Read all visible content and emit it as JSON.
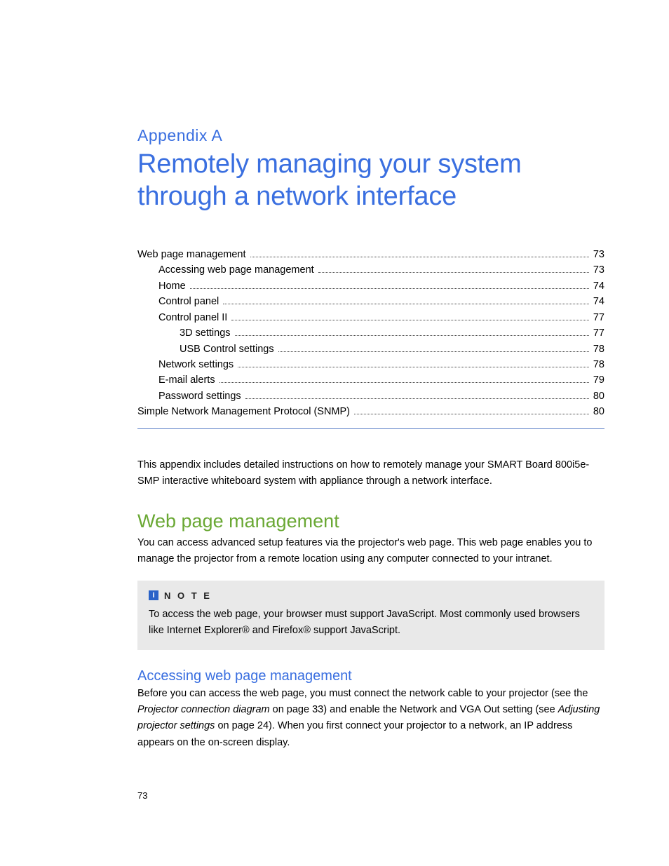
{
  "appendix_label": "Appendix  A",
  "chapter_title": "Remotely managing your system through a network interface",
  "toc": [
    {
      "label": "Web page management",
      "page": "73",
      "indent": 0
    },
    {
      "label": "Accessing web page management",
      "page": "73",
      "indent": 1
    },
    {
      "label": "Home",
      "page": "74",
      "indent": 1
    },
    {
      "label": "Control panel",
      "page": "74",
      "indent": 1
    },
    {
      "label": "Control panel II",
      "page": "77",
      "indent": 1
    },
    {
      "label": "3D settings",
      "page": "77",
      "indent": 2
    },
    {
      "label": "USB Control settings",
      "page": "78",
      "indent": 2
    },
    {
      "label": "Network settings",
      "page": "78",
      "indent": 1
    },
    {
      "label": "E-mail alerts",
      "page": "79",
      "indent": 1
    },
    {
      "label": "Password settings",
      "page": "80",
      "indent": 1
    },
    {
      "label": "Simple Network Management Protocol (SNMP)",
      "page": "80",
      "indent": 0
    }
  ],
  "intro_paragraph": "This appendix includes detailed instructions on how to remotely manage your SMART Board 800i5e-SMP interactive whiteboard system with appliance through a network interface.",
  "section_h2": "Web page management",
  "section_p1": "You can access advanced setup features via the projector's web page. This web page enables you to manage the projector from a remote location using any computer connected to your intranet.",
  "note": {
    "label": "N O T E",
    "icon_glyph": "i",
    "body": "To access the web page, your browser must support JavaScript. Most commonly used browsers like Internet Explorer® and Firefox® support JavaScript."
  },
  "subsection_h3": "Accessing web page management",
  "subsection_p": {
    "t1": "Before you can access the web page, you must connect the network cable to your projector (see the ",
    "i1": "Projector connection diagram",
    "t2": " on page 33) and enable the Network and VGA Out setting (see ",
    "i2": "Adjusting projector settings",
    "t3": " on page 24). When you first connect your projector to a network, an IP address appears on the on-screen display."
  },
  "page_number": "73"
}
